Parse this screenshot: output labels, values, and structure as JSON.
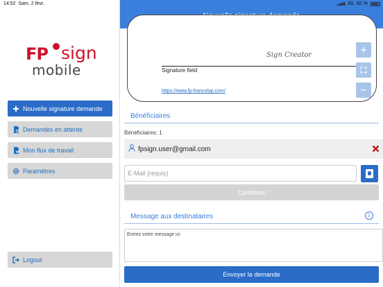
{
  "statusbar": {
    "time": "14:52",
    "date": "Sam. 2 févr.",
    "network": "3G",
    "battery": "82 %"
  },
  "sidebar": {
    "logo": {
      "fp": "FP",
      "sign": "sign",
      "mobile": "mobile"
    },
    "items": [
      {
        "label": "Nouvelle signature demande",
        "icon": "plus-icon",
        "active": true
      },
      {
        "label": "Demandes en attente",
        "icon": "pending-document-icon",
        "active": false
      },
      {
        "label": "Mon flux de travail",
        "icon": "workflow-document-icon",
        "active": false
      },
      {
        "label": "Paramètres",
        "icon": "gear-icon",
        "active": false
      }
    ],
    "logout_label": "Logout"
  },
  "header": {
    "title": "Nouvelle signature demande"
  },
  "signature": {
    "scribble": "Sign Creator",
    "field_label": "Signature field",
    "link": "https://www.fp-francotyp.com/"
  },
  "beneficiaires": {
    "title": "Bénéficiaires",
    "count_label": "Bénéficiaires: 1",
    "items": [
      {
        "email": "fpsign.user@gmail.com"
      }
    ],
    "email_value": "",
    "email_placeholder": "E-Mail (requis)",
    "confirm_label": "Confirmer"
  },
  "message": {
    "title": "Message aux destinataires",
    "value": "",
    "placeholder": "Entrez votre message ici"
  },
  "send_label": "Envoyer la demande",
  "colors": {
    "accent": "#3a7fdb",
    "button_blue": "#2a6cc7",
    "brand_red": "#d0102b",
    "delete_red": "#c0171b",
    "disabled_gray": "#d4d4d4"
  }
}
